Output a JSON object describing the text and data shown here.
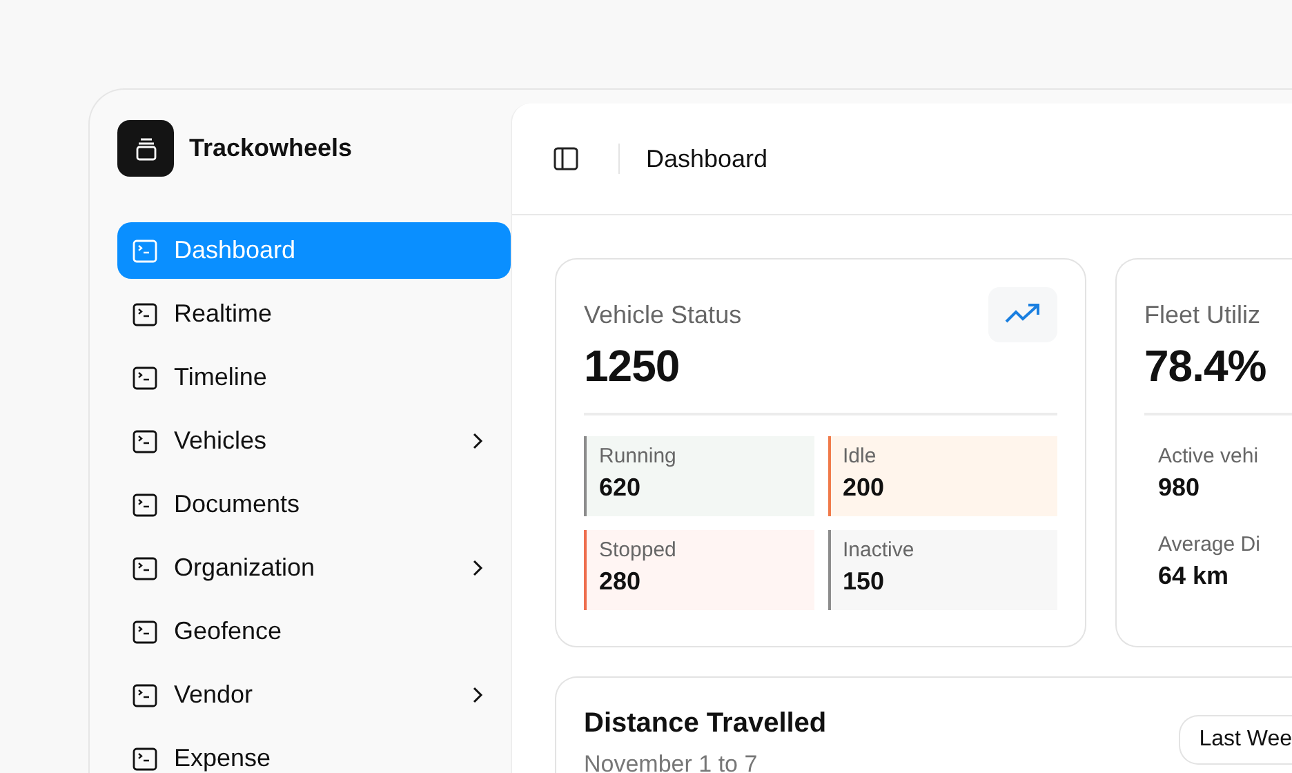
{
  "brand": {
    "name": "Trackowheels"
  },
  "sidebar": {
    "items": [
      {
        "label": "Dashboard",
        "selected": true,
        "has_submenu": false
      },
      {
        "label": "Realtime",
        "selected": false,
        "has_submenu": false
      },
      {
        "label": "Timeline",
        "selected": false,
        "has_submenu": false
      },
      {
        "label": "Vehicles",
        "selected": false,
        "has_submenu": true
      },
      {
        "label": "Documents",
        "selected": false,
        "has_submenu": false
      },
      {
        "label": "Organization",
        "selected": false,
        "has_submenu": true
      },
      {
        "label": "Geofence",
        "selected": false,
        "has_submenu": false
      },
      {
        "label": "Vendor",
        "selected": false,
        "has_submenu": true
      },
      {
        "label": "Expense",
        "selected": false,
        "has_submenu": false
      }
    ]
  },
  "header": {
    "title": "Dashboard"
  },
  "vehicle_status": {
    "title": "Vehicle Status",
    "value": "1250",
    "tiles": [
      {
        "label": "Running",
        "value": "620",
        "kind": "running",
        "color": "#8c8c8c"
      },
      {
        "label": "Idle",
        "value": "200",
        "kind": "idle",
        "color": "#f07a4a"
      },
      {
        "label": "Stopped",
        "value": "280",
        "kind": "stopped",
        "color": "#ee6e4e"
      },
      {
        "label": "Inactive",
        "value": "150",
        "kind": "inactive",
        "color": "#8c8c8c"
      }
    ]
  },
  "fleet_utilization": {
    "title": "Fleet Utiliz",
    "value": "78.4%",
    "stats": [
      {
        "label": "Active vehi",
        "value": "980"
      },
      {
        "label": "Average Di",
        "value": "64 km"
      }
    ]
  },
  "distance_travelled": {
    "title": "Distance Travelled",
    "subtitle": "November 1 to 7",
    "range_button": "Last Wee"
  }
}
